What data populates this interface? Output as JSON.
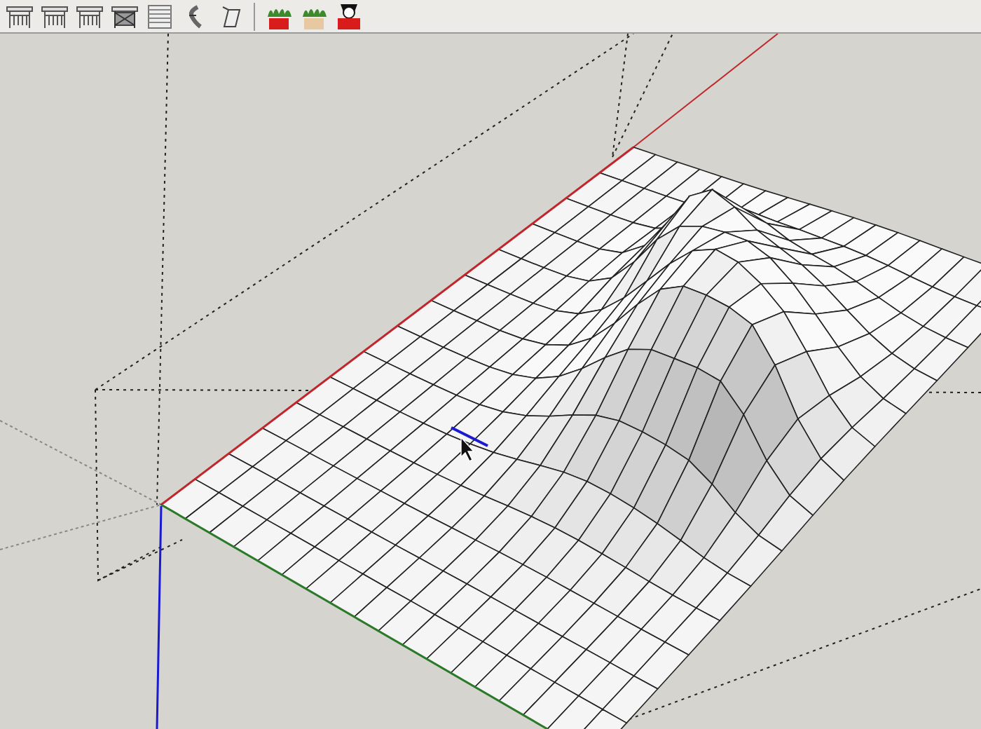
{
  "toolbar": {
    "buttons": [
      {
        "kind": "railing"
      },
      {
        "kind": "railing"
      },
      {
        "kind": "railing"
      },
      {
        "kind": "lattice"
      },
      {
        "kind": "louver"
      },
      {
        "kind": "stair"
      },
      {
        "kind": "post"
      }
    ],
    "plugin_buttons": [
      {
        "kind": "plant",
        "color": "#d81c1c"
      },
      {
        "kind": "plant",
        "color": "#e8c8a0"
      },
      {
        "kind": "cow",
        "color": "#d81c1c"
      }
    ]
  }
}
